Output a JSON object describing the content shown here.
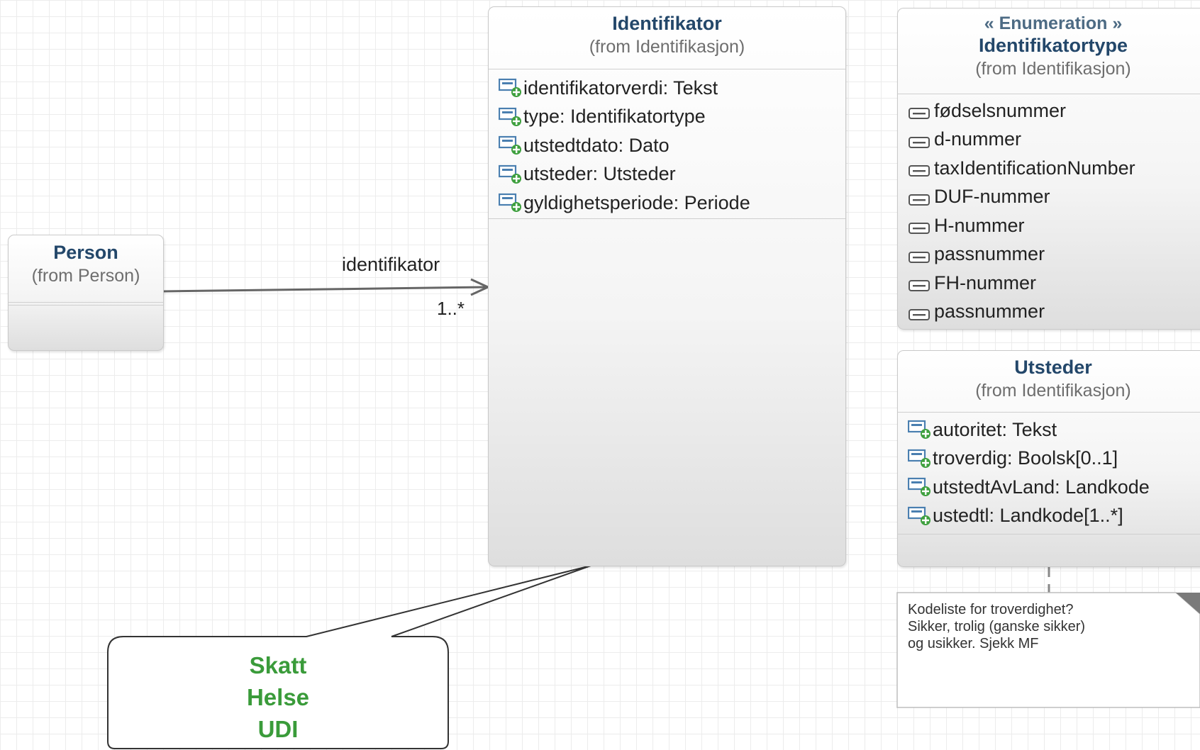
{
  "classes": {
    "person": {
      "name": "Person",
      "from": "(from Person)"
    },
    "identifikator": {
      "name": "Identifikator",
      "from": "(from Identifikasjon)",
      "attributes": [
        "identifikatorverdi: Tekst",
        "type: Identifikatortype",
        "utstedtdato: Dato",
        "utsteder: Utsteder",
        "gyldighetsperiode: Periode"
      ]
    },
    "identifikatortype": {
      "stereotype": "« Enumeration »",
      "name": "Identifikatortype",
      "from": "(from Identifikasjon)",
      "literals": [
        "fødselsnummer",
        "d-nummer",
        "taxIdentificationNumber",
        "DUF-nummer",
        "H-nummer",
        "passnummer",
        "FH-nummer",
        "passnummer"
      ]
    },
    "utsteder": {
      "name": "Utsteder",
      "from": "(from Identifikasjon)",
      "attributes": [
        "autoritet: Tekst",
        "troverdig: Boolsk[0..1]",
        "utstedtAvLand: Landkode",
        "ustedtl: Landkode[1..*]"
      ]
    }
  },
  "association": {
    "role": "identifikator",
    "multiplicity": "1..*"
  },
  "note": {
    "lines": [
      "Kodeliste for troverdighet?",
      "Sikker, trolig (ganske sikker)",
      "og usikker. Sjekk MF"
    ]
  },
  "callout": {
    "lines": [
      "Skatt",
      "Helse",
      "UDI"
    ]
  },
  "colors": {
    "class_name": "#23476a",
    "stereotype": "#4d6b84",
    "callout_text": "#3a9b3a",
    "icon_plus": "#3fa03f",
    "icon_frame": "#4a7fb0"
  },
  "icons": {
    "attribute": "attribute-plus-icon",
    "literal": "enum-literal-icon"
  }
}
